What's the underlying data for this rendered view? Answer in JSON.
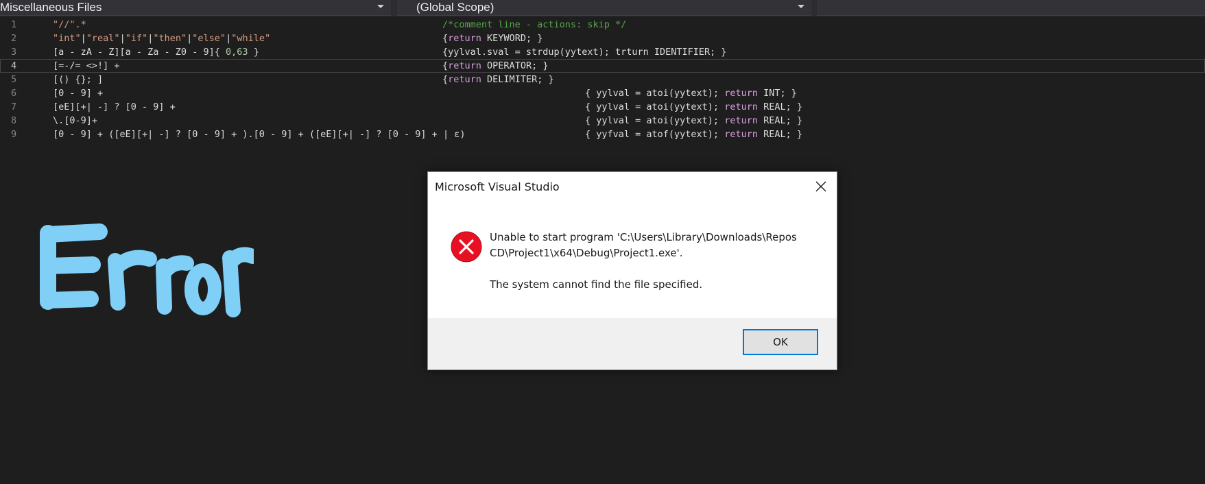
{
  "nav": {
    "project": "Miscellaneous Files",
    "scope": "(Global Scope)"
  },
  "editor": {
    "current_line": 4,
    "lines": [
      {
        "n": "1",
        "pattern": [
          {
            "t": "\"//\".*",
            "c": "str"
          }
        ],
        "action": [
          {
            "t": "/*comment line - actions: skip */",
            "c": "com"
          }
        ],
        "col": "a1"
      },
      {
        "n": "2",
        "pattern": [
          {
            "t": "\"int\"",
            "c": "str"
          },
          {
            "t": "|",
            "c": "plain"
          },
          {
            "t": "\"real\"",
            "c": "str"
          },
          {
            "t": "|",
            "c": "plain"
          },
          {
            "t": "\"if\"",
            "c": "str"
          },
          {
            "t": "|",
            "c": "plain"
          },
          {
            "t": "\"then\"",
            "c": "str"
          },
          {
            "t": "|",
            "c": "plain"
          },
          {
            "t": "\"else\"",
            "c": "str"
          },
          {
            "t": "|",
            "c": "plain"
          },
          {
            "t": "\"while\"",
            "c": "str"
          }
        ],
        "action": [
          {
            "t": "{",
            "c": "plain"
          },
          {
            "t": "return",
            "c": "kw"
          },
          {
            "t": " KEYWORD; }",
            "c": "plain"
          }
        ],
        "col": "a1"
      },
      {
        "n": "3",
        "pattern": [
          {
            "t": "[a - zA - Z][a - Za - Z0 - 9]{ ",
            "c": "plain"
          },
          {
            "t": "0,63",
            "c": "num"
          },
          {
            "t": " }",
            "c": "plain"
          }
        ],
        "action": [
          {
            "t": "{yylval.sval = strdup(yytext); trturn IDENTIFIER; }",
            "c": "plain"
          }
        ],
        "col": "a1"
      },
      {
        "n": "4",
        "pattern": [
          {
            "t": "[=-/= <>!] +",
            "c": "plain"
          }
        ],
        "action": [
          {
            "t": "{",
            "c": "plain"
          },
          {
            "t": "return",
            "c": "kw"
          },
          {
            "t": " OPERATOR; }",
            "c": "plain"
          }
        ],
        "col": "a1"
      },
      {
        "n": "5",
        "pattern": [
          {
            "t": "[() {}; ]",
            "c": "plain"
          }
        ],
        "action": [
          {
            "t": "{",
            "c": "plain"
          },
          {
            "t": "return",
            "c": "kw"
          },
          {
            "t": " DELIMITER; }",
            "c": "plain"
          }
        ],
        "col": "a1"
      },
      {
        "n": "6",
        "pattern": [
          {
            "t": "[0 - 9] +",
            "c": "plain"
          }
        ],
        "action": [
          {
            "t": "{ yylval = atoi(yytext); ",
            "c": "plain"
          },
          {
            "t": "return",
            "c": "kw"
          },
          {
            "t": " INT; }",
            "c": "plain"
          }
        ],
        "col": "a2"
      },
      {
        "n": "7",
        "pattern": [
          {
            "t": "[eE][+| -] ? [0 - 9] +",
            "c": "plain"
          }
        ],
        "action": [
          {
            "t": "{ yylval = atoi(yytext); ",
            "c": "plain"
          },
          {
            "t": "return",
            "c": "kw"
          },
          {
            "t": " REAL; }",
            "c": "plain"
          }
        ],
        "col": "a2"
      },
      {
        "n": "8",
        "pattern": [
          {
            "t": "\\.[0-9]+",
            "c": "plain"
          }
        ],
        "action": [
          {
            "t": "{ yylval = atoi(yytext); ",
            "c": "plain"
          },
          {
            "t": "return",
            "c": "kw"
          },
          {
            "t": " REAL; }",
            "c": "plain"
          }
        ],
        "col": "a2"
      },
      {
        "n": "9",
        "pattern": [
          {
            "t": "[0 - 9] + ([eE][+| -] ? [0 - 9] + ).[0 - 9] + ([eE][+| -] ? [0 - 9] + | ε)",
            "c": "plain"
          }
        ],
        "action": [
          {
            "t": "{ yyfval = atof(yytext); ",
            "c": "plain"
          },
          {
            "t": "return",
            "c": "kw"
          },
          {
            "t": " REAL; }",
            "c": "plain"
          }
        ],
        "col": "a2"
      }
    ]
  },
  "annotation": {
    "text": "Error",
    "color": "#7fcff7"
  },
  "dialog": {
    "title": "Microsoft Visual Studio",
    "message_line1": "Unable to start program 'C:\\Users\\Library\\Downloads\\Repos",
    "message_line2": "CD\\Project1\\x64\\Debug\\Project1.exe'.",
    "message_line3": "The system cannot find the file specified.",
    "ok_label": "OK",
    "icon": "error-icon",
    "accent_color": "#0078d7",
    "error_color": "#e81123"
  }
}
